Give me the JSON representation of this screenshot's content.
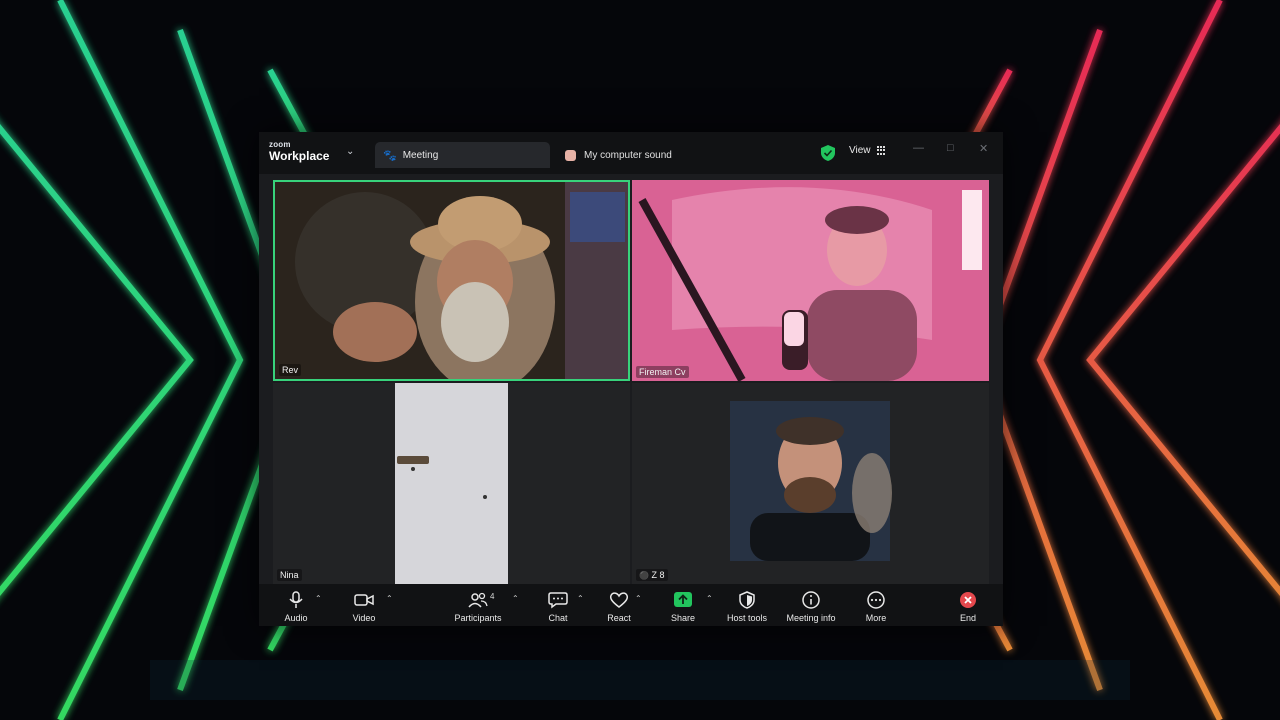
{
  "app": {
    "brand_top": "zoom",
    "brand_bottom": "Workplace",
    "tab_meeting": "Meeting",
    "tab_sound": "My computer sound",
    "view_label": "View"
  },
  "participants_grid": [
    {
      "name": "Rev",
      "active_speaker": true
    },
    {
      "name": "Fireman Cv",
      "active_speaker": false
    },
    {
      "name": "Nina",
      "active_speaker": false
    },
    {
      "name": "Z 8",
      "active_speaker": false,
      "muted": true
    }
  ],
  "toolbar": {
    "audio": "Audio",
    "video": "Video",
    "participants": "Participants",
    "participants_count": "4",
    "chat": "Chat",
    "react": "React",
    "share": "Share",
    "host_tools": "Host tools",
    "meeting_info": "Meeting info",
    "more": "More",
    "end": "End"
  },
  "colors": {
    "active_speaker_border": "#38d27b",
    "share_green": "#22c55e",
    "end_red": "#e5484d",
    "neon_left": "#35f08a",
    "neon_right": "#ff2d6a"
  }
}
